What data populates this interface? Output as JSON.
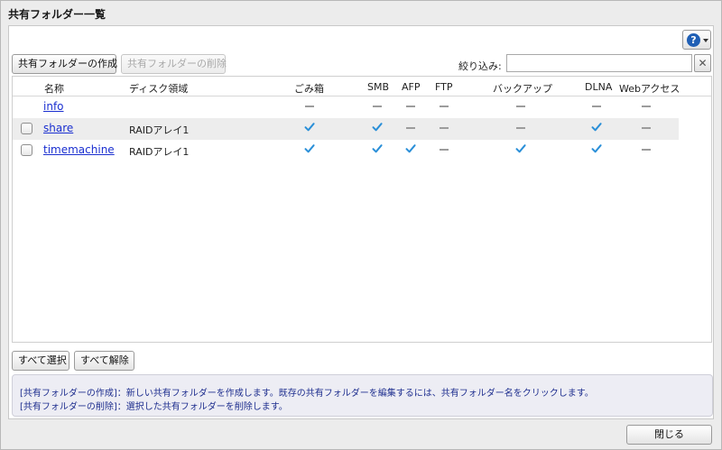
{
  "dialog": {
    "title": "共有フォルダー一覧"
  },
  "help": {
    "icon": "help-icon",
    "glyph": "?"
  },
  "toolbar": {
    "create_label": "共有フォルダーの作成",
    "delete_label": "共有フォルダーの削除",
    "filter_label": "絞り込み:",
    "filter_value": "",
    "clear_glyph": "✕"
  },
  "table": {
    "columns": [
      "名称",
      "ディスク領域",
      "ごみ箱",
      "SMB",
      "AFP",
      "FTP",
      "バックアップ",
      "DLNA",
      "Webアクセス"
    ],
    "rows": [
      {
        "name": "info",
        "disk": "",
        "checkbox": false,
        "trash": "off",
        "smb": "off",
        "afp": "off",
        "ftp": "off",
        "backup": "off",
        "dlna": "off",
        "web": "off"
      },
      {
        "name": "share",
        "disk": "RAIDアレイ1",
        "checkbox": true,
        "trash": "on",
        "smb": "on",
        "afp": "off",
        "ftp": "off",
        "backup": "off",
        "dlna": "on",
        "web": "off"
      },
      {
        "name": "timemachine",
        "disk": "RAIDアレイ1",
        "checkbox": true,
        "trash": "on",
        "smb": "on",
        "afp": "on",
        "ftp": "off",
        "backup": "on",
        "dlna": "on",
        "web": "off"
      }
    ]
  },
  "selection": {
    "select_all_label": "すべて選択",
    "deselect_all_label": "すべて解除"
  },
  "info": {
    "line1": "[共有フォルダーの作成]：新しい共有フォルダーを作成します。既存の共有フォルダーを編集するには、共有フォルダー名をクリックします。",
    "line2": "[共有フォルダーの削除]：選択した共有フォルダーを削除します。"
  },
  "footer": {
    "close_label": "閉じる"
  },
  "colors": {
    "check": "#2a8fd8",
    "link": "#1a2fd0",
    "info_text": "#1f2f8f",
    "help": "#1f5fb5"
  }
}
